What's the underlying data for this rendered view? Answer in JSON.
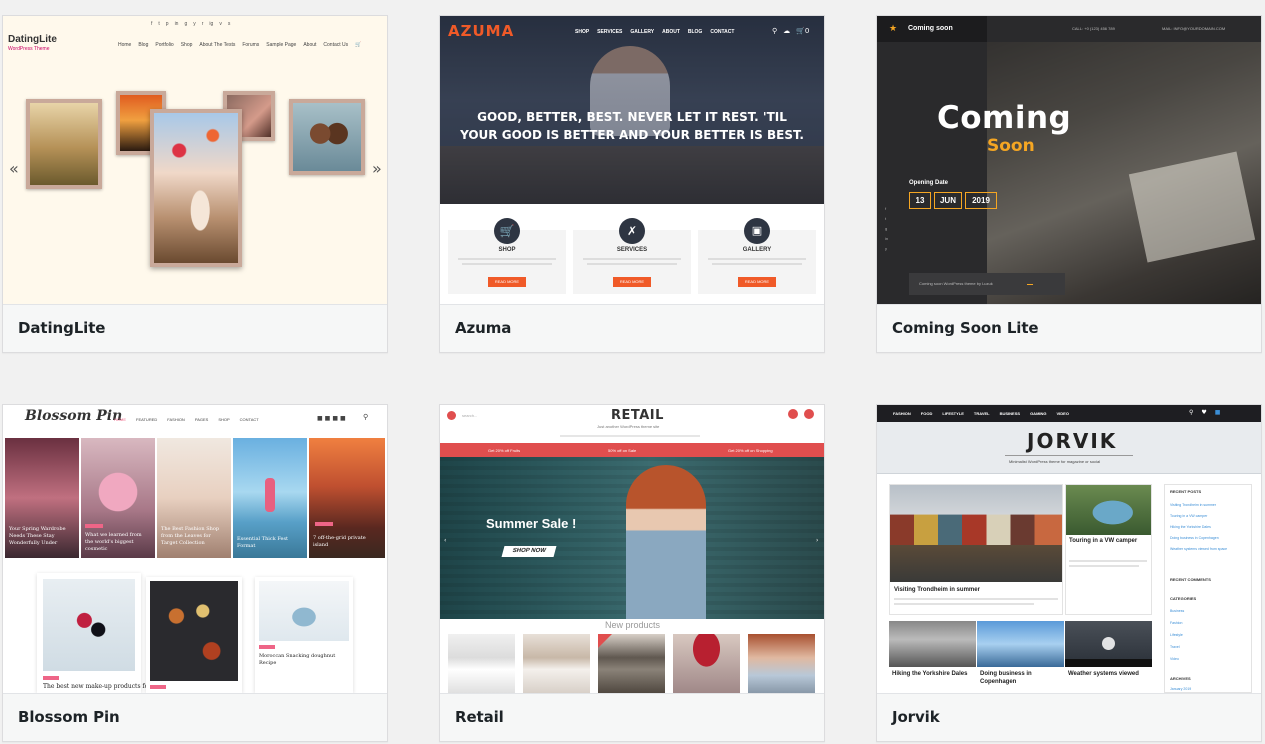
{
  "themes": [
    {
      "name": "DatingLite",
      "preview": {
        "logo": "DatingLite",
        "tagline": "WordPress Theme",
        "social": [
          "f",
          "t",
          "p",
          "in",
          "g",
          "y",
          "r",
          "ig",
          "v",
          "s"
        ],
        "menu": [
          "Home",
          "Blog",
          "Portfolio",
          "Shop",
          "About The Tests",
          "Forums",
          "Sample Page",
          "About",
          "Contact Us"
        ],
        "arrow_left": "«",
        "arrow_right": "»"
      }
    },
    {
      "name": "Azuma",
      "preview": {
        "logo": "AZUMA",
        "menu": [
          "SHOP",
          "SERVICES",
          "GALLERY",
          "ABOUT",
          "BLOG",
          "CONTACT"
        ],
        "cart": "0",
        "hero_text": "GOOD, BETTER, BEST. NEVER LET IT REST. 'TIL YOUR GOOD IS BETTER AND YOUR BETTER IS BEST.",
        "features": [
          {
            "title": "SHOP",
            "button": "READ MORE"
          },
          {
            "title": "SERVICES",
            "button": "READ MORE"
          },
          {
            "title": "GALLERY",
            "button": "READ MORE"
          }
        ],
        "accent": "#f05a28"
      }
    },
    {
      "name": "Coming Soon Lite",
      "preview": {
        "brand": "Coming soon",
        "call": "CALL: +0 (123) 456 789",
        "email": "MAIL: INFO@YOURDOMAIN.COM",
        "title_line1": "Coming",
        "title_line2": "Soon",
        "opening_label": "Opening Date",
        "date": [
          "13",
          "JUN",
          "2019"
        ],
        "footer": "Coming soon WordPress theme by Luzuk",
        "accent": "#f5a623"
      }
    },
    {
      "name": "Blossom Pin",
      "preview": {
        "logo": "Blossom Pin",
        "menu": [
          "HOME",
          "FEATURED",
          "FASHION",
          "PAGES",
          "SHOP",
          "CONTACT"
        ],
        "slides": [
          {
            "caption": "Your Spring Wardrobe Needs These Stay Wonderfully Under"
          },
          {
            "caption": "What we learned from the world's biggest cosmetic"
          },
          {
            "caption": "The Best Fashion Shop from the Leaves for Target Collection"
          },
          {
            "caption": "Essential Thick Fest Format"
          },
          {
            "caption": "7 off-the-grid private island"
          }
        ],
        "posts": [
          {
            "title": "The best new make-up products for"
          },
          {
            "title": ""
          },
          {
            "title": "Moroccan Snacking doughnut Recipe"
          }
        ],
        "accent": "#ee6587"
      }
    },
    {
      "name": "Retail",
      "preview": {
        "logo": "RETAIL",
        "tagline": "Just another WordPress theme site",
        "promos": [
          "Get 20% off Fruits",
          "50% off on Sale",
          "Get 20% off on Shopping"
        ],
        "hero_title": "Summer Sale !",
        "hero_button": "SHOP NOW",
        "section_title": "New products",
        "accent": "#e04e4e"
      }
    },
    {
      "name": "Jorvik",
      "preview": {
        "logo": "JORVIK",
        "tagline": "Minimalist WordPress theme for magazine or social",
        "menu": [
          "FASHION",
          "FOOD",
          "LIFESTYLE",
          "TRAVEL",
          "BUSINESS",
          "GAMING",
          "VIDEO"
        ],
        "main_post": "Visiting Trondheim in summer",
        "side_post": "Touring in a VW camper",
        "bottom_posts": [
          "Hiking the Yorkshire Dales",
          "Doing business in Copenhagen",
          "Weather systems viewed"
        ],
        "widgets": [
          "RECENT POSTS",
          "RECENT COMMENTS",
          "CATEGORIES",
          "ARCHIVES"
        ],
        "recent": [
          "Visiting Trondheim in summer",
          "Touring in a VW camper",
          "Hiking the Yorkshire Dales",
          "Doing business in Copenhagen",
          "Weather systems viewed from space"
        ],
        "categories": [
          "Business",
          "Fashion",
          "Lifestyle",
          "Travel",
          "Video"
        ],
        "archive": "January 2019",
        "accent": "#3b8ed6"
      }
    }
  ]
}
